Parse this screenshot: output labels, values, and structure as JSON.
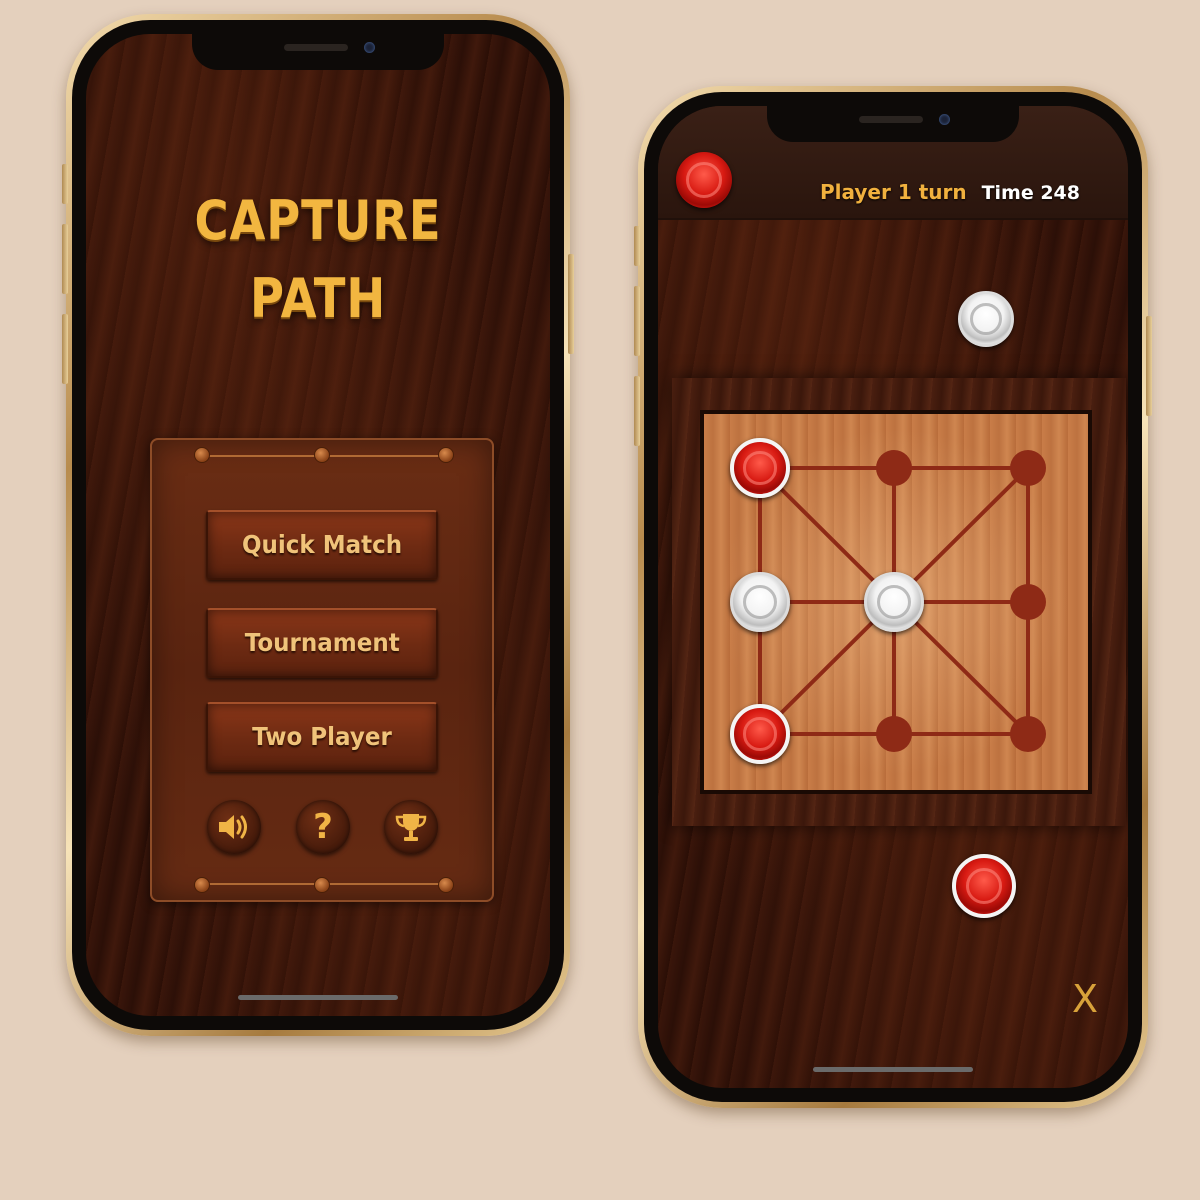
{
  "menu_screen": {
    "title_line1": "CAPTURE",
    "title_line2": "PATH",
    "buttons": {
      "quick_match": "Quick Match",
      "tournament": "Tournament",
      "two_player": "Two Player"
    },
    "icons": [
      "speaker-icon",
      "help-icon",
      "trophy-icon"
    ],
    "help_glyph": "?"
  },
  "game_screen": {
    "turn_text": "Player 1 turn",
    "time_text": "Time 248",
    "close_glyph": "X",
    "current_player_color": "red",
    "board": {
      "rows": 3,
      "cols": 3,
      "cells": [
        [
          "red",
          "empty",
          "empty"
        ],
        [
          "white",
          "white",
          "empty"
        ],
        [
          "red",
          "empty",
          "empty"
        ]
      ]
    },
    "reserve": {
      "top": "white",
      "bottom": "red"
    }
  },
  "colors": {
    "background": "#e4d0bd",
    "title_gold": "#f2b640",
    "button_text": "#f0c37a",
    "turn_text": "#f1b13e",
    "red_piece": "#d81a12",
    "white_piece": "#f2f2f2",
    "board_line": "#8e2a16"
  }
}
